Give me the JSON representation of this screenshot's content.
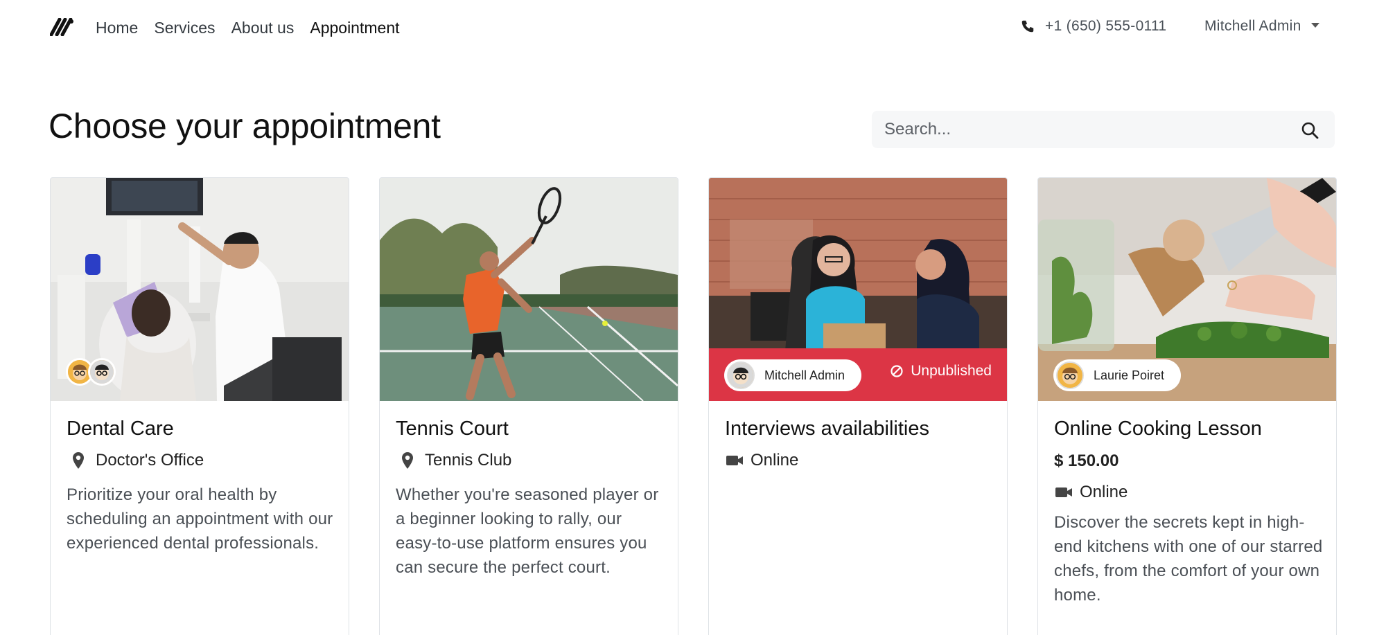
{
  "header": {
    "nav": [
      "Home",
      "Services",
      "About us",
      "Appointment"
    ],
    "active_nav": "Appointment",
    "phone": "+1 (650) 555-0111",
    "user": "Mitchell Admin"
  },
  "main": {
    "title": "Choose your appointment",
    "search_placeholder": "Search..."
  },
  "cards": [
    {
      "title": "Dental Care",
      "location": "Doctor's Office",
      "description": "Prioritize your oral health by scheduling an appointment with our experienced dental professionals."
    },
    {
      "title": "Tennis Court",
      "location": "Tennis Club",
      "description": "Whether you're seasoned player or a beginner looking to rally, our easy-to-use platform ensures you can secure the perfect court."
    },
    {
      "title": "Interviews availabilities",
      "location": "Online",
      "staff": "Mitchell Admin",
      "status": "Unpublished"
    },
    {
      "title": "Online Cooking Lesson",
      "price": "$ 150.00",
      "location": "Online",
      "staff": "Laurie Poiret",
      "description": "Discover the secrets kept in high-end kitchens with one of our starred chefs, from the comfort of your own home."
    }
  ],
  "colors": {
    "unpublished_band": "#dc3545",
    "search_bg": "#f6f7f8",
    "card_border": "#dee2e6"
  },
  "icons": [
    "logo-icon",
    "phone-icon",
    "caret-down-icon",
    "search-icon",
    "map-pin-icon",
    "video-camera-icon",
    "ban-icon",
    "avatar"
  ]
}
